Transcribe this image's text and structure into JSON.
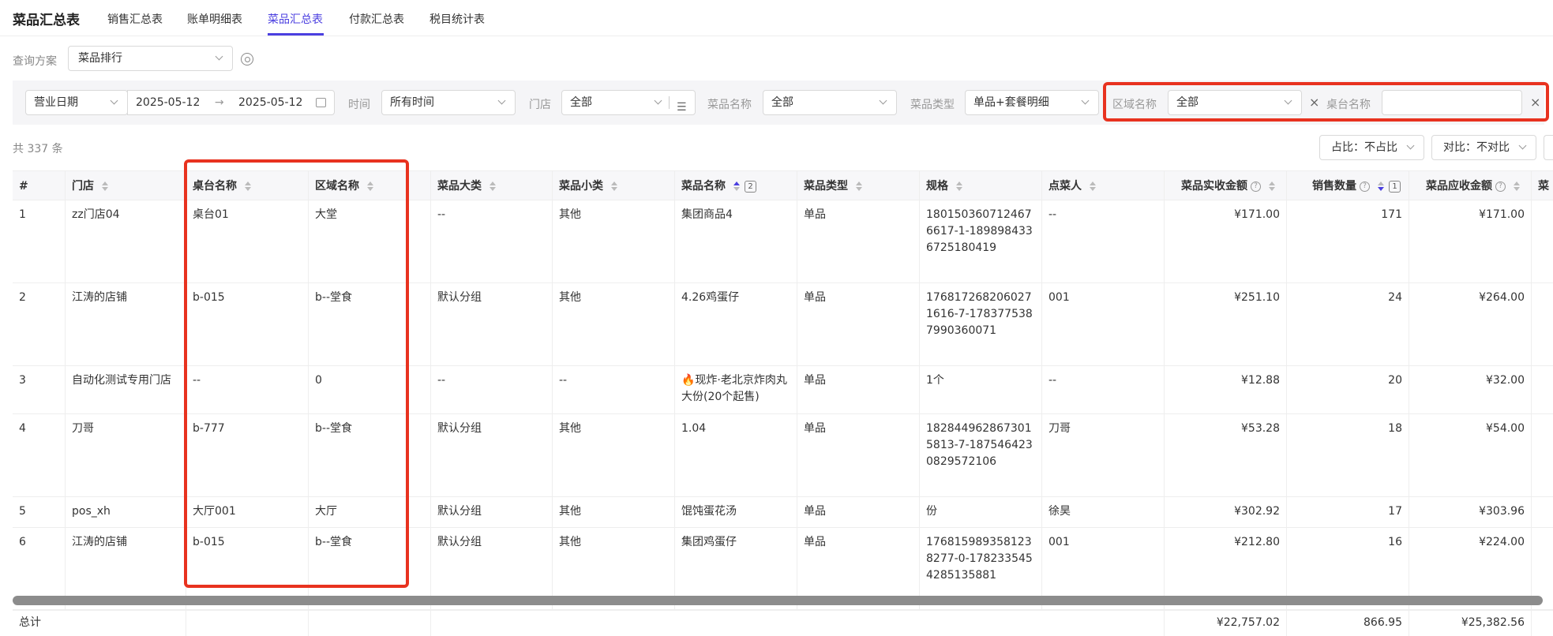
{
  "header": {
    "title": "菜品汇总表",
    "tabs": [
      "销售汇总表",
      "账单明细表",
      "菜品汇总表",
      "付款汇总表",
      "税目统计表"
    ]
  },
  "query": {
    "label": "查询方案",
    "value": "菜品排行"
  },
  "filters": {
    "date_type": "营业日期",
    "date_start": "2025-05-12",
    "date_sep": "→",
    "date_end": "2025-05-12",
    "time_label": "时间",
    "time_value": "所有时间",
    "store_label": "门店",
    "store_value": "全部",
    "dish_name_label": "菜品名称",
    "dish_name_value": "全部",
    "dish_type_label": "菜品类型",
    "dish_type_value": "单品+套餐明细",
    "area_label": "区域名称",
    "area_value": "全部",
    "table_label": "桌台名称",
    "table_value": ""
  },
  "summary": {
    "count": "共 337 条",
    "ratio_btn": "占比：不占比",
    "compare_btn": "对比：不对比"
  },
  "table": {
    "headers": [
      "#",
      "门店",
      "桌台名称",
      "区域名称",
      "菜品大类",
      "菜品小类",
      "菜品名称",
      "菜品类型",
      "规格",
      "点菜人",
      "菜品实收金额",
      "销售数量",
      "菜品应收金额",
      "菜"
    ],
    "dish_name_sort_badge": "2",
    "qty_sort_badge": "1",
    "rows": [
      [
        "1",
        "zz门店04",
        "桌台01",
        "大堂",
        "--",
        "其他",
        "集团商品4",
        "单品",
        "1801503607124676617-1-1898984336725180419",
        "--",
        "¥171.00",
        "171",
        "¥171.00"
      ],
      [
        "2",
        "江涛的店铺",
        "b-015",
        "b--堂食",
        "默认分组",
        "其他",
        "4.26鸡蛋仔",
        "单品",
        "1768172682060271616-7-1783775387990360071",
        "001",
        "¥251.10",
        "24",
        "¥264.00"
      ],
      [
        "3",
        "自动化测试专用门店",
        "--",
        "0",
        "--",
        "--",
        "🔥现炸·老北京炸肉丸大份(20个起售)",
        "单品",
        "1个",
        "--",
        "¥12.88",
        "20",
        "¥32.00"
      ],
      [
        "4",
        "刀哥",
        "b-777",
        "b--堂食",
        "默认分组",
        "其他",
        "1.04",
        "单品",
        "1828449628673015813-7-1875464230829572106",
        "刀哥",
        "¥53.28",
        "18",
        "¥54.00"
      ],
      [
        "5",
        "pos_xh",
        "大厅001",
        "大厅",
        "默认分组",
        "其他",
        "馄饨蛋花汤",
        "单品",
        "份",
        "徐昊",
        "¥302.92",
        "17",
        "¥303.96"
      ],
      [
        "6",
        "江涛的店铺",
        "b-015",
        "b--堂食",
        "默认分组",
        "其他",
        "集团鸡蛋仔",
        "单品",
        "1768159893581238277-0-1782335454285135881",
        "001",
        "¥212.80",
        "16",
        "¥224.00"
      ]
    ],
    "total": {
      "label": "总计",
      "amount": "¥22,757.02",
      "qty": "866.95",
      "receivable": "¥25,382.56"
    }
  },
  "colors": {
    "accent": "#4b3fe0",
    "highlight": "#e8321f"
  }
}
